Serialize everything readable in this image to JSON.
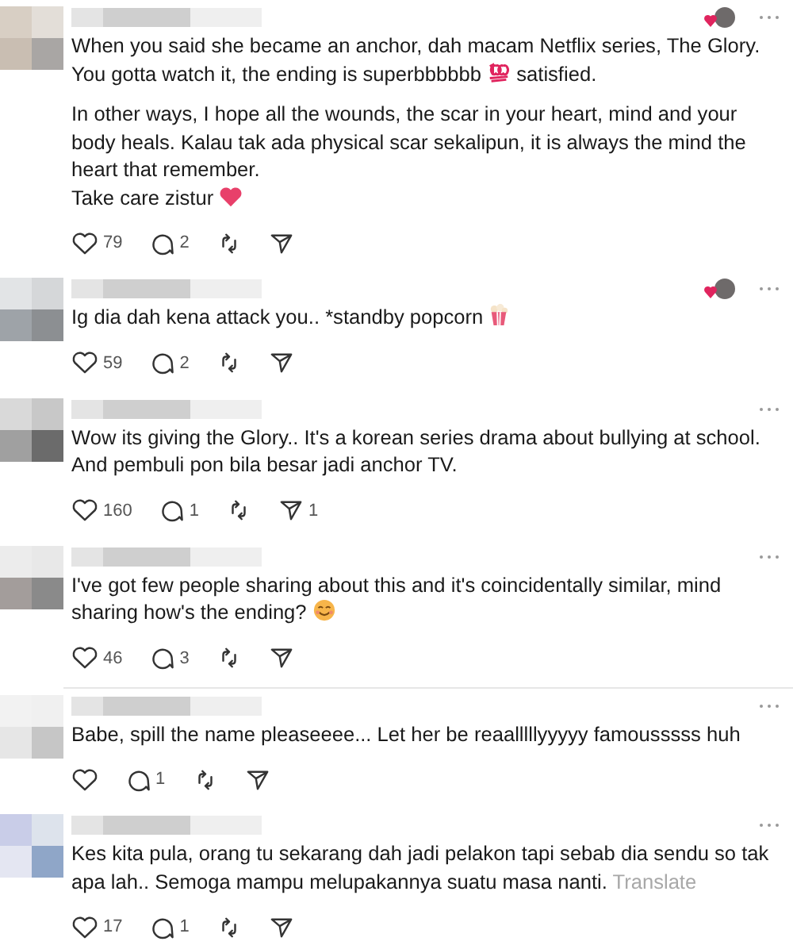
{
  "comments": [
    {
      "liked_by_author": true,
      "paragraphs": [
        {
          "lines": [
            [
              {
                "kind": "text",
                "text": "When you said she became an anchor, dah macam Netflix series, The Glory. You gotta watch it, the ending is superbbbbbb "
              },
              {
                "kind": "hundred_emoji"
              },
              {
                "kind": "text",
                "text": " satisfied."
              }
            ]
          ]
        },
        {
          "lines": [
            [
              {
                "kind": "text",
                "text": "In other ways, I hope all the wounds, the scar in your heart, mind and your body heals. Kalau tak ada physical scar sekalipun, it is always the mind the heart that remember."
              }
            ],
            [
              {
                "kind": "text",
                "text": "Take care zistur "
              },
              {
                "kind": "heart_emoji"
              }
            ]
          ]
        }
      ],
      "likes": "79",
      "replies": "2"
    },
    {
      "liked_by_author": true,
      "paragraphs": [
        {
          "lines": [
            [
              {
                "kind": "text",
                "text": "Ig dia dah kena attack you.. *standby popcorn "
              },
              {
                "kind": "popcorn_emoji"
              }
            ]
          ]
        }
      ],
      "likes": "59",
      "replies": "2"
    },
    {
      "liked_by_author": false,
      "paragraphs": [
        {
          "lines": [
            [
              {
                "kind": "text",
                "text": "Wow its giving the Glory.. It's a korean series drama about bullying at school. And pembuli pon bila besar jadi anchor TV."
              }
            ]
          ]
        }
      ],
      "likes": "160",
      "replies": "1",
      "shares": "1"
    },
    {
      "liked_by_author": false,
      "paragraphs": [
        {
          "lines": [
            [
              {
                "kind": "text",
                "text": "I've got few people sharing about this and it's coincidentally similar, mind sharing how's the ending? "
              },
              {
                "kind": "smile_emoji"
              }
            ]
          ]
        }
      ],
      "likes": "46",
      "replies": "3"
    },
    {
      "liked_by_author": false,
      "paragraphs": [
        {
          "lines": [
            [
              {
                "kind": "text",
                "text": "Babe, spill the name pleaseeee... Let her be reaalllllyyyyy famousssss huh"
              }
            ]
          ]
        }
      ],
      "replies": "1"
    },
    {
      "liked_by_author": false,
      "paragraphs": [
        {
          "lines": [
            [
              {
                "kind": "text",
                "text": "Kes kita pula, orang tu sekarang dah jadi pelakon tapi sebab dia sendu so tak apa lah.. Semoga mampu melupakannya suatu masa nanti. "
              },
              {
                "kind": "translate",
                "text": "Translate"
              }
            ]
          ]
        }
      ],
      "likes": "17",
      "replies": "1"
    }
  ]
}
